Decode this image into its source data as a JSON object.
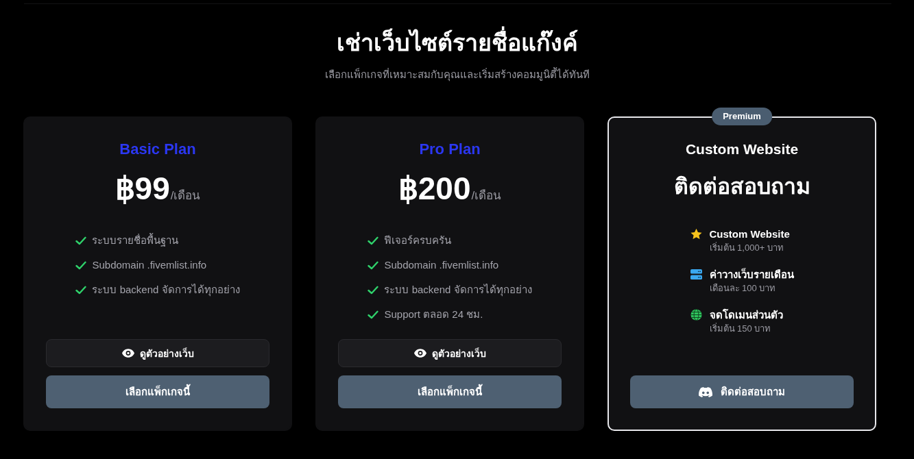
{
  "header": {
    "title": "เช่าเว็บไซต์รายชื่อแก๊งค์",
    "subtitle": "เลือกแพ็กเกจที่เหมาะสมกับคุณและเริ่มสร้างคอมมูนิตี้ได้ทันที"
  },
  "plans": [
    {
      "kind": "standard",
      "highlighted": false,
      "name": "Basic Plan",
      "price": "฿99",
      "period": "/เดือน",
      "features": [
        "ระบบรายชื่อพื้นฐาน",
        "Subdomain .fivemlist.info",
        "ระบบ backend จัดการได้ทุกอย่าง"
      ],
      "preview_button": "ดูตัวอย่างเว็บ",
      "select_button": "เลือกแพ็กเกจนี้"
    },
    {
      "kind": "standard",
      "highlighted": false,
      "name": "Pro Plan",
      "price": "฿200",
      "period": "/เดือน",
      "features": [
        "ฟีเจอร์ครบครัน",
        "Subdomain .fivemlist.info",
        "ระบบ backend จัดการได้ทุกอย่าง",
        "Support ตลอด 24 ชม."
      ],
      "preview_button": "ดูตัวอย่างเว็บ",
      "select_button": "เลือกแพ็กเกจนี้"
    },
    {
      "kind": "custom",
      "highlighted": true,
      "badge": "Premium",
      "name": "Custom Website",
      "price": "ติดต่อสอบถาม",
      "items": [
        {
          "title": "Custom Website",
          "subtitle": "เริ่มต้น 1,000+ บาท"
        },
        {
          "title": "ค่าวางเว็บรายเดือน",
          "subtitle": "เดือนละ 100 บาท"
        },
        {
          "title": "จดโดเมนส่วนตัว",
          "subtitle": "เริ่มต้น 150 บาท"
        }
      ],
      "contact_button": "ติดต่อสอบถาม"
    }
  ]
}
